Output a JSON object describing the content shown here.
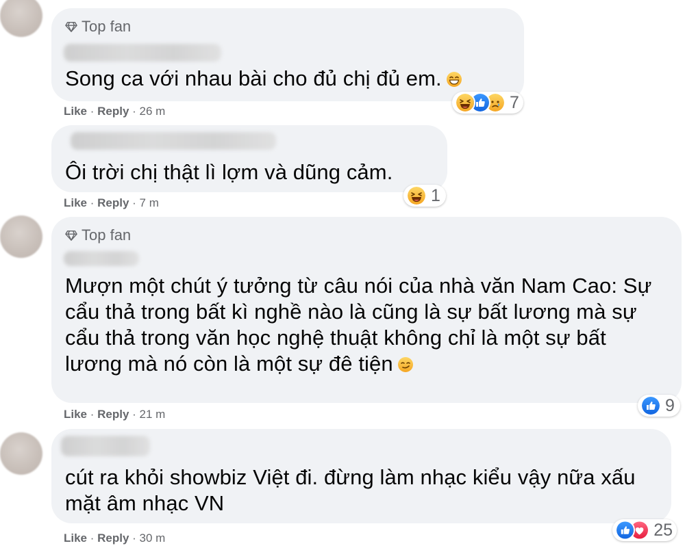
{
  "comments": [
    {
      "badge": "Top fan",
      "text": "Song ca với nhau bài cho đủ chị đủ em.",
      "like": "Like",
      "reply": "Reply",
      "time": "26 m",
      "reaction_count": "7"
    },
    {
      "badge": "",
      "text": "Ôi trời chị thật lì lợm và dũng cảm.",
      "like": "Like",
      "reply": "Reply",
      "time": "7 m",
      "reaction_count": "1"
    },
    {
      "badge": "Top fan",
      "text": "Mượn một chút ý tưởng từ câu nói của nhà văn Nam Cao: Sự cẩu thả trong bất kì nghề nào là cũng là sự bất lương mà sự cẩu thả trong văn học nghệ thuật không chỉ là một sự bất lương mà nó còn là một sự đê tiện",
      "like": "Like",
      "reply": "Reply",
      "time": "21 m",
      "reaction_count": "9"
    },
    {
      "badge": "",
      "text": "cút ra khỏi showbiz Việt đi. đừng làm nhạc kiểu vậy nữa xấu mặt âm nhạc VN",
      "like": "Like",
      "reply": "Reply",
      "time": "30 m",
      "reaction_count": "25"
    }
  ],
  "icons": {
    "badge_icon": "diamond-icon",
    "reactions_c1": [
      "haha-icon",
      "like-icon",
      "sad-icon"
    ],
    "reactions_c2": [
      "haha-icon"
    ],
    "reactions_c3": [
      "like-icon"
    ],
    "reactions_c4": [
      "like-icon",
      "love-icon"
    ],
    "inline_emoji_c1": "grin-emoji",
    "inline_emoji_c3": "smirk-emoji"
  },
  "colors": {
    "bubble": "#f0f2f5",
    "text": "#050505",
    "meta": "#65676b",
    "like_blue": "#1877f2",
    "love_red": "#f33e58",
    "emoji_yellow": "#f7b125"
  }
}
